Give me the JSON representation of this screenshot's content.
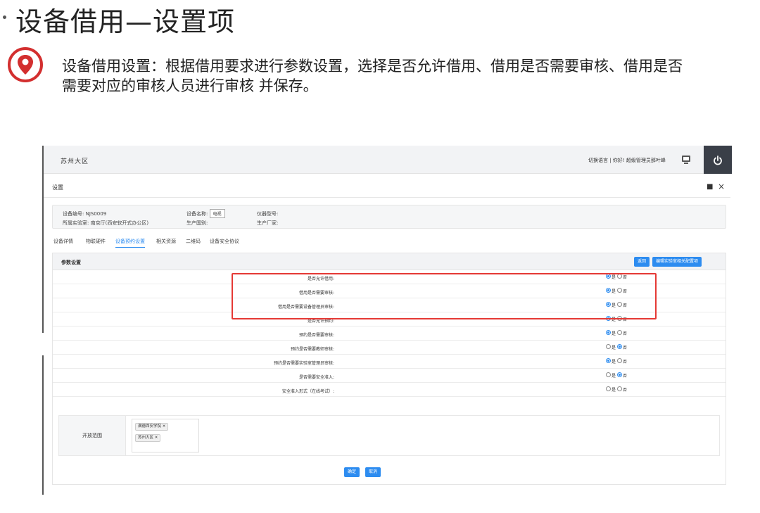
{
  "slide": {
    "title": "设备借用—设置项",
    "description": "设备借用设置：根据借用要求进行参数设置，选择是否允许借用、借用是否需要审核、借用是否需要对应的审核人员进行审核 并保存。"
  },
  "app": {
    "brand": "苏州大区",
    "top_links": "切换语言 | 你好! 超级管理员那叶峰",
    "power_icon": "power-icon",
    "window_title": "设置"
  },
  "device_info": {
    "device_no_label": "设备编号:",
    "device_no": "NJS0009",
    "lab_label": "所属实验室:",
    "lab": "南京厅(西安软开式办公区)",
    "name_label": "设备名称:",
    "name": "电视",
    "country_label": "生产国别:",
    "model_label": "仪器型号:",
    "maker_label": "生产厂家:"
  },
  "tabs": [
    {
      "label": "设备详情",
      "active": false
    },
    {
      "label": "物联硬件",
      "active": false
    },
    {
      "label": "设备预约设置",
      "active": true
    },
    {
      "label": "相关资源",
      "active": false
    },
    {
      "label": "二维码",
      "active": false
    },
    {
      "label": "设备安全协议",
      "active": false
    }
  ],
  "panel": {
    "title": "参数设置",
    "back_button": "返回",
    "edit_button": "编辑实验室相关配置项"
  },
  "settings_rows": [
    {
      "label": "是否允许借用:",
      "yes": "是",
      "no": "否",
      "selected": "yes"
    },
    {
      "label": "借用是否需要审核:",
      "yes": "是",
      "no": "否",
      "selected": "yes"
    },
    {
      "label": "借用是否需要设备管理员审核:",
      "yes": "是",
      "no": "否",
      "selected": "yes"
    },
    {
      "label": "是否允许预约:",
      "yes": "是",
      "no": "否",
      "selected": "yes"
    },
    {
      "label": "预约是否需要审核:",
      "yes": "是",
      "no": "否",
      "selected": "yes"
    },
    {
      "label": "预约是否需要教师审核:",
      "yes": "是",
      "no": "否",
      "selected": "no"
    },
    {
      "label": "预约是否需要实验室管理员审核:",
      "yes": "是",
      "no": "否",
      "selected": "yes"
    },
    {
      "label": "是否需要安全准入:",
      "yes": "是",
      "no": "否",
      "selected": "no"
    },
    {
      "label": "安全准入形式（在线考试）:",
      "yes": "是",
      "no": "否",
      "selected": "none"
    }
  ],
  "scope": {
    "label": "开放范围",
    "tags": [
      "满德西安学院",
      "苏州大区"
    ]
  },
  "footer": {
    "confirm": "确定",
    "cancel": "取消"
  },
  "colors": {
    "accent": "#2d8cf0",
    "highlight": "#e53935",
    "pin": "#d32f2f"
  }
}
